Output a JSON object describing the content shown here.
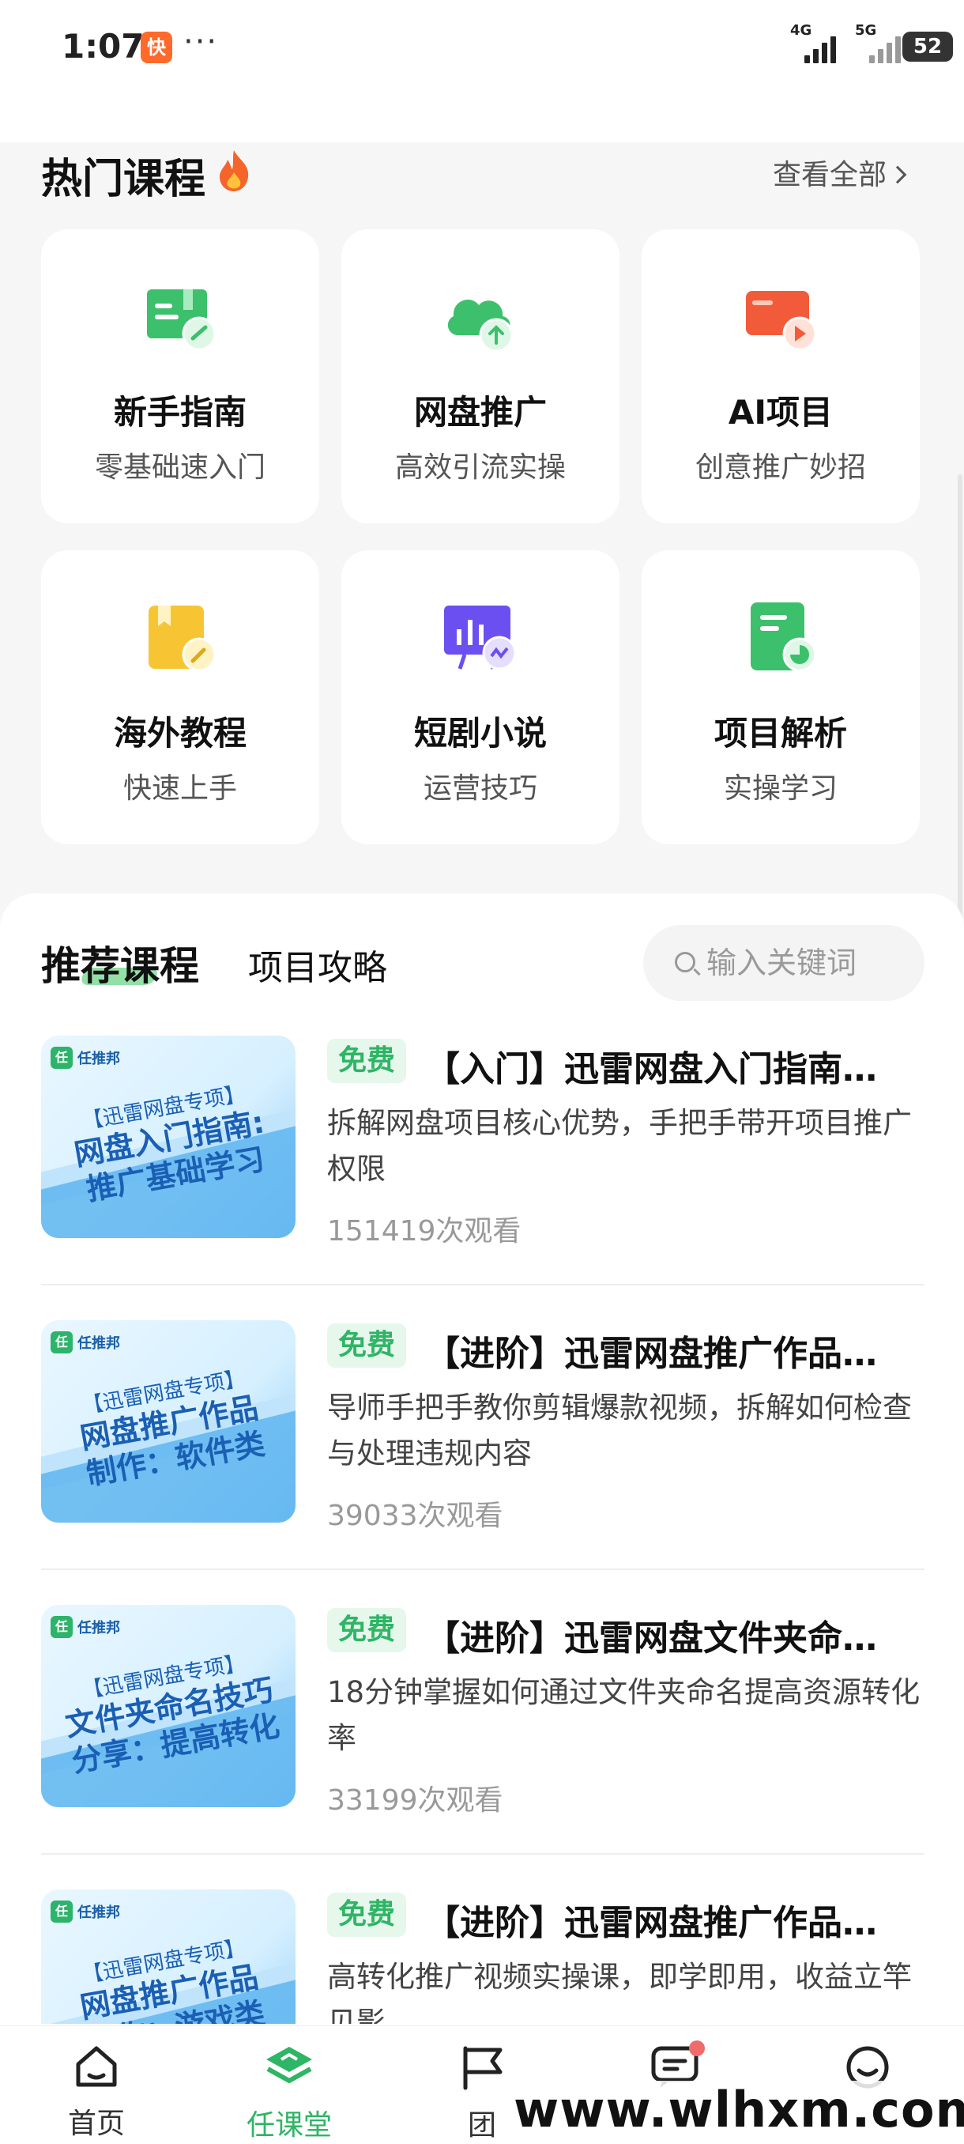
{
  "status_bar": {
    "time": "1:07",
    "app_icon_glyph": "快",
    "dots": "···",
    "net1": "4G",
    "net2": "5G",
    "battery": "52"
  },
  "hot": {
    "title": "热门课程",
    "see_all": "查看全部",
    "cards": [
      {
        "title": "新手指南",
        "subtitle": "零基础速入门",
        "icon": "book-guide-icon",
        "color": "#3cc06c"
      },
      {
        "title": "网盘推广",
        "subtitle": "高效引流实操",
        "icon": "cloud-upload-icon",
        "color": "#3cc06c"
      },
      {
        "title": "AI项目",
        "subtitle": "创意推广妙招",
        "icon": "video-play-icon",
        "color": "#f25b3a"
      },
      {
        "title": "海外教程",
        "subtitle": "快速上手",
        "icon": "bookmark-edit-icon",
        "color": "#f7c534"
      },
      {
        "title": "短剧小说",
        "subtitle": "运营技巧",
        "icon": "presentation-chart-icon",
        "color": "#6b4ff0"
      },
      {
        "title": "项目解析",
        "subtitle": "实操学习",
        "icon": "document-chart-icon",
        "color": "#3cc06c"
      }
    ]
  },
  "recommend": {
    "tab_active": "推荐课程",
    "tab_other": "项目攻略",
    "search_placeholder": "输入关键词",
    "courses": [
      {
        "badge": "免费",
        "title": "【入门】迅雷网盘入门指南…",
        "desc": "拆解网盘项目核心优势，手把手带开项目推广权限",
        "views": "151419次观看",
        "thumb_logo": "任推邦",
        "thumb_l1": "【迅雷网盘专项】",
        "thumb_l2": "网盘入门指南:",
        "thumb_l3": "推广基础学习"
      },
      {
        "badge": "免费",
        "title": "【进阶】迅雷网盘推广作品…",
        "desc": "导师手把手教你剪辑爆款视频，拆解如何检查与处理违规内容",
        "views": "39033次观看",
        "thumb_logo": "任推邦",
        "thumb_l1": "【迅雷网盘专项】",
        "thumb_l2": "网盘推广作品",
        "thumb_l3": "制作：软件类"
      },
      {
        "badge": "免费",
        "title": "【进阶】迅雷网盘文件夹命…",
        "desc": "18分钟掌握如何通过文件夹命名提高资源转化率",
        "views": "33199次观看",
        "thumb_logo": "任推邦",
        "thumb_l1": "【迅雷网盘专项】",
        "thumb_l2": "文件夹命名技巧",
        "thumb_l3": "分享：提高转化"
      },
      {
        "badge": "免费",
        "title": "【进阶】迅雷网盘推广作品…",
        "desc": "高转化推广视频实操课，即学即用，收益立竿见影",
        "views": "",
        "thumb_logo": "任推邦",
        "thumb_l1": "【迅雷网盘专项】",
        "thumb_l2": "网盘推广作品",
        "thumb_l3": "制作：游戏类"
      }
    ]
  },
  "nav": {
    "items": [
      {
        "label": "首页",
        "icon": "home-icon"
      },
      {
        "label": "任课堂",
        "icon": "layers-icon",
        "active": true
      },
      {
        "label": "团",
        "icon": "flag-icon"
      },
      {
        "label": "",
        "icon": "message-icon"
      },
      {
        "label": "",
        "icon": "profile-icon"
      }
    ]
  },
  "watermark": "www.wlhxm.com",
  "colors": {
    "accent": "#2eb565",
    "badge_bg": "#e6f7ec",
    "dot": "#f06b6b"
  }
}
